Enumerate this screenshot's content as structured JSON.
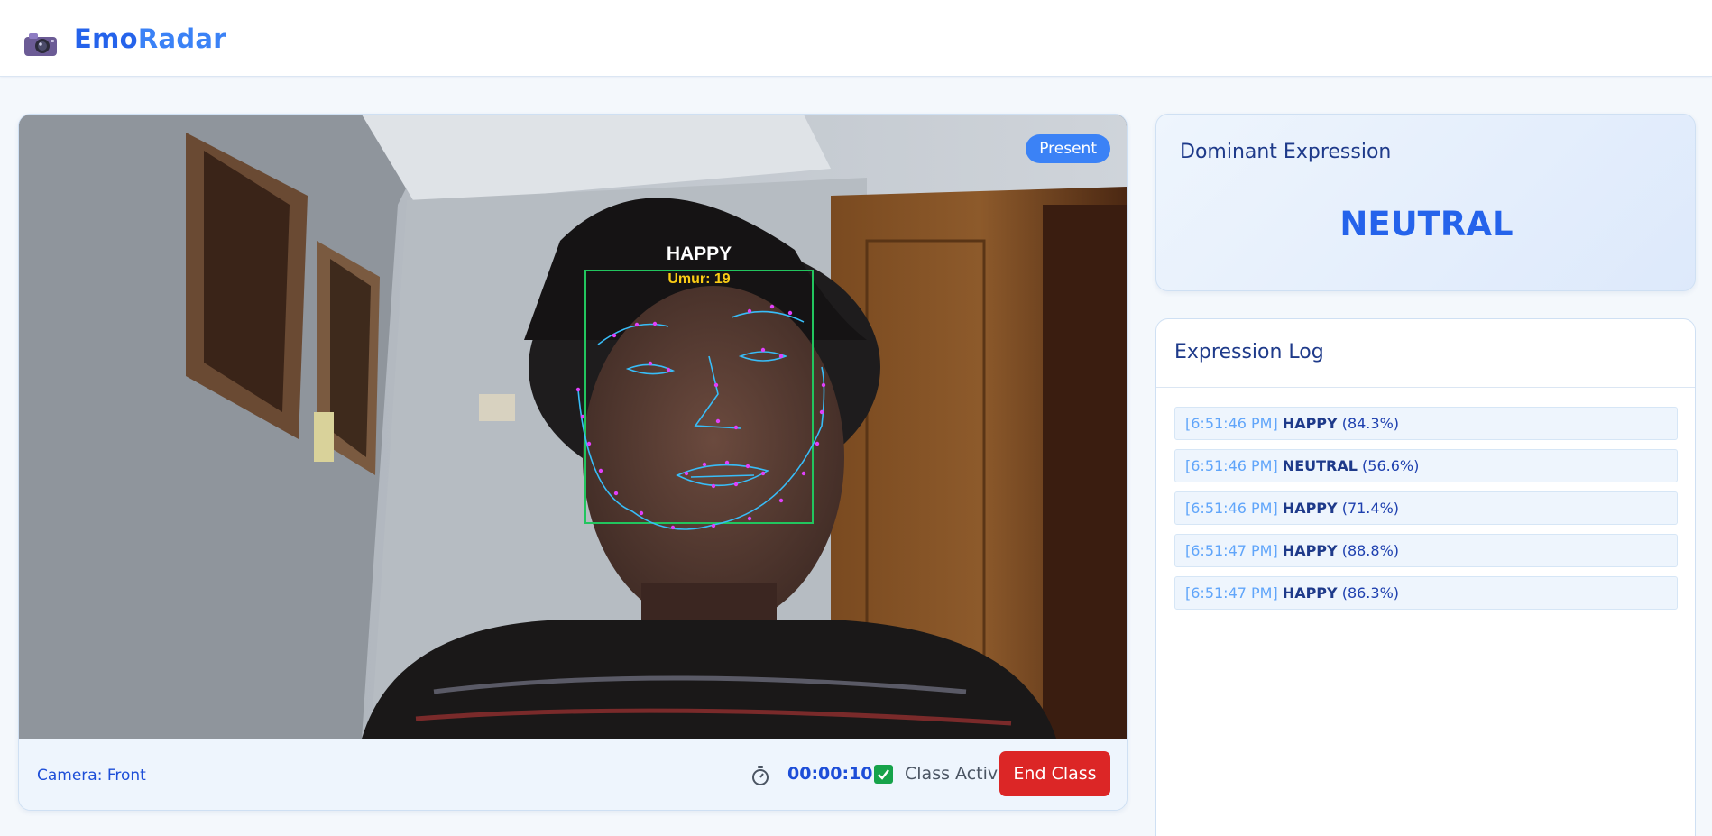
{
  "app": {
    "brand_part1": "Emo",
    "brand_part2": "Radar",
    "logo_icon": "camera-icon"
  },
  "video": {
    "status_badge": "Present",
    "face_label": "HAPPY",
    "age_label": "Umur: 19"
  },
  "footer": {
    "camera": "Camera: Front",
    "timer": "00:00:10",
    "class_active_label": "Class Active",
    "class_active_checked": true,
    "end_button": "End Class"
  },
  "dominant": {
    "title": "Dominant Expression",
    "value": "NEUTRAL"
  },
  "log": {
    "title": "Expression Log",
    "items": [
      {
        "time": "[6:51:46 PM]",
        "expression": "HAPPY",
        "confidence": "(84.3%)"
      },
      {
        "time": "[6:51:46 PM]",
        "expression": "NEUTRAL",
        "confidence": "(56.6%)"
      },
      {
        "time": "[6:51:46 PM]",
        "expression": "HAPPY",
        "confidence": "(71.4%)"
      },
      {
        "time": "[6:51:47 PM]",
        "expression": "HAPPY",
        "confidence": "(88.8%)"
      },
      {
        "time": "[6:51:47 PM]",
        "expression": "HAPPY",
        "confidence": "(86.3%)"
      }
    ]
  },
  "colors": {
    "accent": "#2563eb",
    "danger": "#dc2626",
    "success": "#16a34a",
    "face_box": "#22c55e",
    "landmark_line": "#38bdf8",
    "landmark_point": "#e040fb",
    "age_text": "#facc15"
  }
}
